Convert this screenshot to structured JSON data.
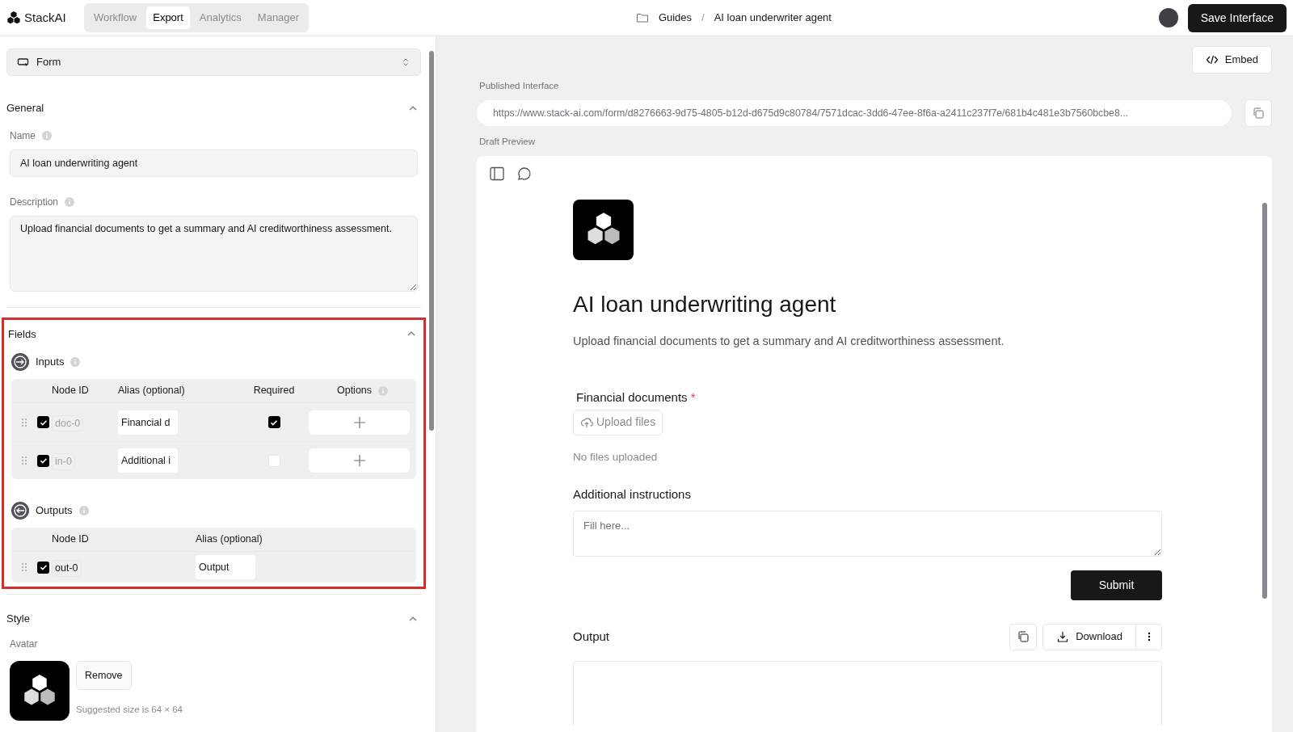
{
  "app": {
    "brand": "StackAI"
  },
  "tabs": [
    {
      "label": "Workflow",
      "selected": false
    },
    {
      "label": "Export",
      "selected": true
    },
    {
      "label": "Analytics",
      "selected": false
    },
    {
      "label": "Manager",
      "selected": false
    }
  ],
  "breadcrumb": [
    "Guides",
    "AI loan underwriter agent"
  ],
  "breadcrumb_separator": "/",
  "save_button": "Save Interface",
  "sidebar": {
    "type_select": "Form",
    "general": {
      "title": "General",
      "expanded": true,
      "name_label": "Name",
      "name_value": "AI loan underwriting agent",
      "description_label": "Description",
      "description_value": "Upload financial documents to get a summary and AI creditworthiness assessment."
    },
    "fields": {
      "title": "Fields",
      "expanded": true,
      "highlighted": true,
      "inputs": {
        "title": "Inputs",
        "columns": [
          "Node ID",
          "Alias (optional)",
          "Required",
          "Options"
        ],
        "rows": [
          {
            "enabled": true,
            "node_id": "doc-0",
            "alias": "Financial d",
            "required": true
          },
          {
            "enabled": true,
            "node_id": "in-0",
            "alias": "Additional i",
            "required": false
          }
        ]
      },
      "outputs": {
        "title": "Outputs",
        "columns": [
          "Node ID",
          "Alias (optional)"
        ],
        "rows": [
          {
            "enabled": true,
            "node_id": "out-0",
            "alias": "Output"
          }
        ]
      }
    },
    "style": {
      "title": "Style",
      "expanded": true,
      "avatar_label": "Avatar",
      "remove_button": "Remove",
      "hint": "Suggested size is 64 × 64"
    }
  },
  "main": {
    "embed_button": "Embed",
    "published_label": "Published Interface",
    "published_url": "https://www.stack-ai.com/form/d8276663-9d75-4805-b12d-d675d9c80784/7571dcac-3dd6-47ee-8f6a-a2411c237f7e/681b4c481e3b7560bcbe8...",
    "draft_label": "Draft Preview",
    "preview": {
      "title": "AI loan underwriting agent",
      "description": "Upload financial documents to get a summary and AI creditworthiness assessment.",
      "file_label": "Financial documents",
      "file_required": true,
      "required_mark": "*",
      "upload_button": "Upload files",
      "no_files": "No files uploaded",
      "instructions_label": "Additional instructions",
      "instructions_placeholder": "Fill here...",
      "submit_button": "Submit",
      "output_label": "Output",
      "download_button": "Download"
    }
  }
}
